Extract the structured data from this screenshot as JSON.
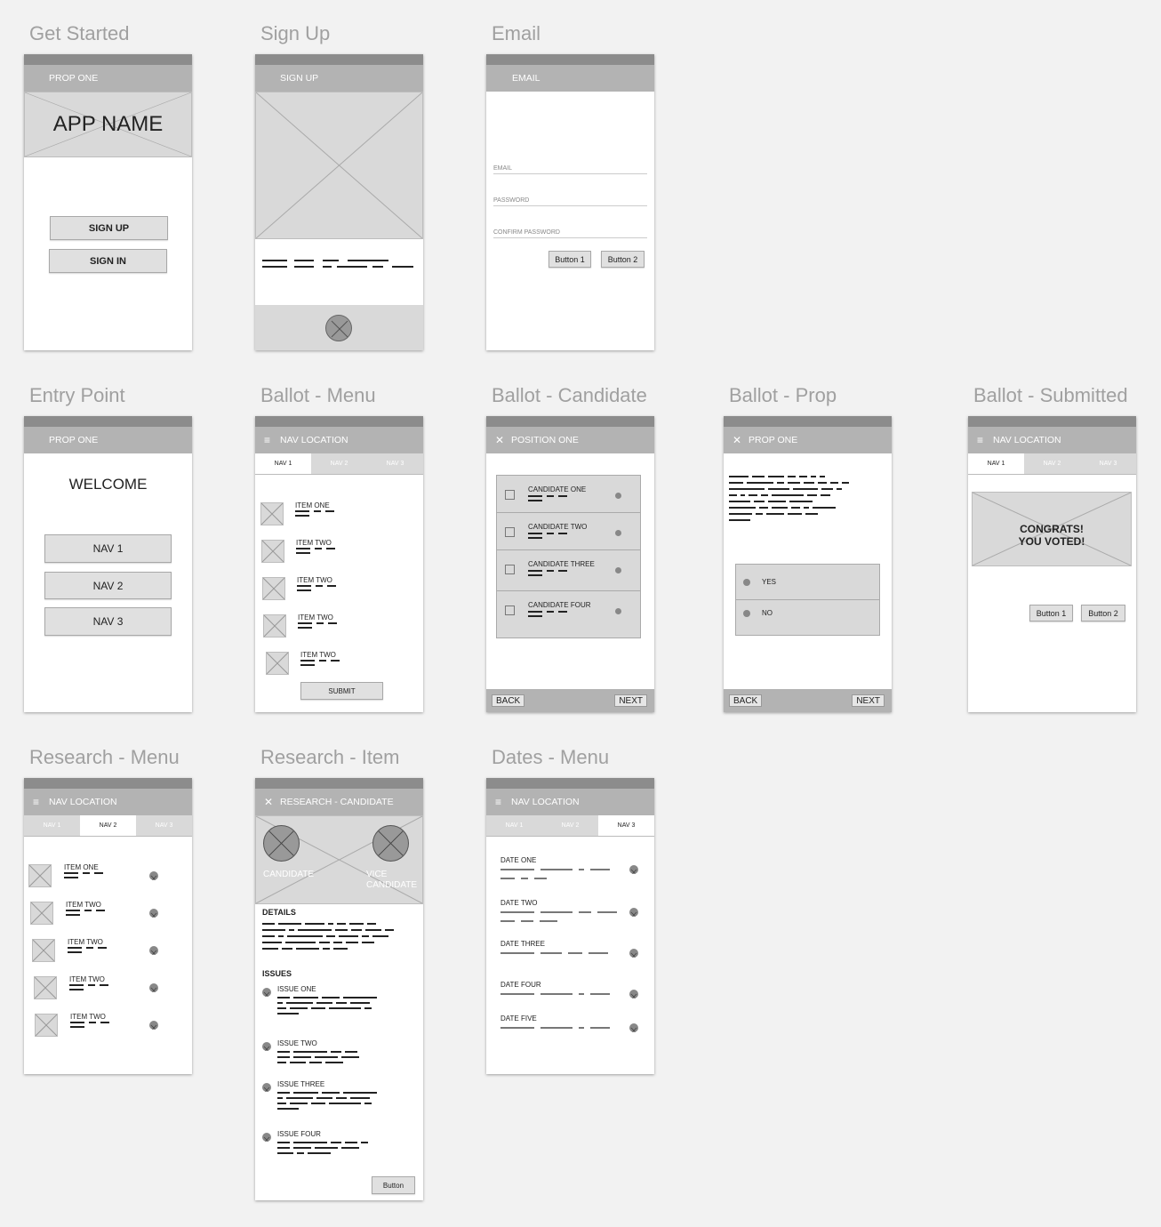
{
  "frames": [
    {
      "title": "Get Started"
    },
    {
      "title": "Sign Up"
    },
    {
      "title": "Email"
    },
    {
      "title": "Entry Point"
    },
    {
      "title": "Ballot - Menu"
    },
    {
      "title": "Ballot - Candidate"
    },
    {
      "title": "Ballot - Prop"
    },
    {
      "title": "Ballot - Submitted"
    },
    {
      "title": "Research - Menu"
    },
    {
      "title": "Research - Item"
    },
    {
      "title": "Dates - Menu"
    }
  ],
  "get_started": {
    "header": "PROP ONE",
    "app_name": "APP NAME",
    "sign_up": "SIGN UP",
    "sign_in": "SIGN IN"
  },
  "sign_up": {
    "header": "SIGN UP"
  },
  "email": {
    "header": "EMAIL",
    "fields": [
      "EMAIL",
      "PASSWORD",
      "CONFIRM PASSWORD"
    ],
    "button1": "Button 1",
    "button2": "Button 2"
  },
  "entry": {
    "header": "PROP ONE",
    "welcome": "WELCOME",
    "navs": [
      "NAV 1",
      "NAV 2",
      "NAV 3"
    ]
  },
  "ballot_menu": {
    "header": "NAV LOCATION",
    "tabs": [
      "NAV 1",
      "NAV 2",
      "NAV 3"
    ],
    "items": [
      "ITEM ONE",
      "ITEM TWO",
      "ITEM TWO",
      "ITEM TWO",
      "ITEM TWO"
    ],
    "submit": "SUBMIT"
  },
  "ballot_candidate": {
    "header": "POSITION ONE",
    "candidates": [
      "CANDIDATE ONE",
      "CANDIDATE TWO",
      "CANDIDATE THREE",
      "CANDIDATE FOUR"
    ],
    "back": "BACK",
    "next": "NEXT"
  },
  "ballot_prop": {
    "header": "PROP ONE",
    "options": [
      "YES",
      "NO"
    ],
    "back": "BACK",
    "next": "NEXT"
  },
  "ballot_submitted": {
    "header": "NAV LOCATION",
    "tabs": [
      "NAV 1",
      "NAV 2",
      "NAV 3"
    ],
    "line1": "CONGRATS!",
    "line2": "YOU VOTED!",
    "button1": "Button 1",
    "button2": "Button 2"
  },
  "research_menu": {
    "header": "NAV LOCATION",
    "tabs": [
      "NAV 1",
      "NAV 2",
      "NAV 3"
    ],
    "items": [
      "ITEM ONE",
      "ITEM TWO",
      "ITEM TWO",
      "ITEM TWO",
      "ITEM TWO"
    ]
  },
  "research_item": {
    "header": "RESEARCH - CANDIDATE",
    "candidate": "CANDIDATE",
    "vice1": "VICE",
    "vice2": "CANDIDATE",
    "details": "DETAILS",
    "issues": "ISSUES",
    "issue_list": [
      "ISSUE ONE",
      "ISSUE TWO",
      "ISSUE THREE",
      "ISSUE FOUR"
    ],
    "button": "Button"
  },
  "dates_menu": {
    "header": "NAV LOCATION",
    "tabs": [
      "NAV 1",
      "NAV 2",
      "NAV 3"
    ],
    "dates": [
      "DATE ONE",
      "DATE TWO",
      "DATE THREE",
      "DATE FOUR",
      "DATE FIVE"
    ]
  },
  "icons": {
    "menu": "hamburger-icon",
    "close": "close-icon",
    "placeholder": "image-placeholder-icon",
    "selected": "x-circle-icon"
  },
  "colors": {
    "appbar": "#b3b3b3",
    "status": "#8c8c8c",
    "background": "#f2f2f2",
    "placeholder": "#d9d9d9"
  }
}
